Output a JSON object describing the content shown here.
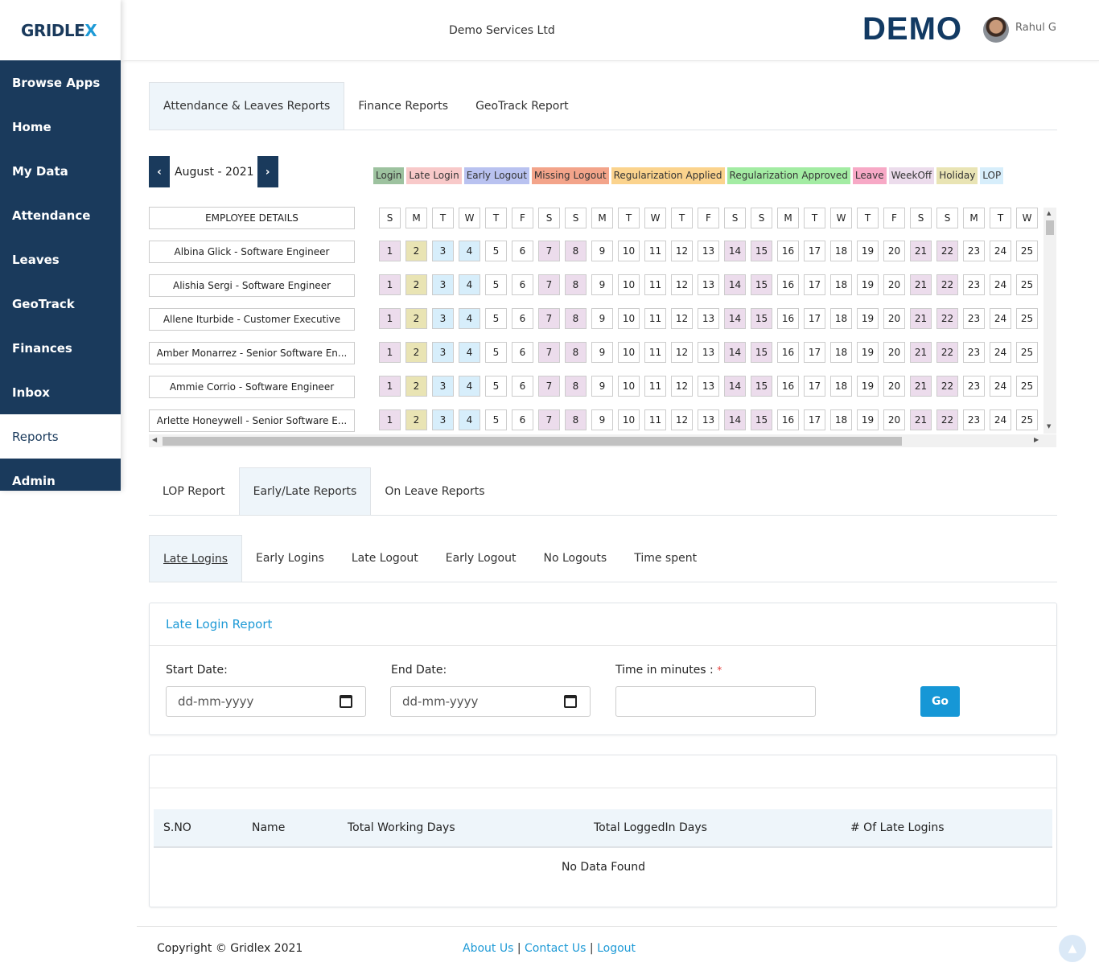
{
  "sidebar": {
    "logo_main": "GRIDLE",
    "logo_x": "X",
    "items": [
      {
        "label": "Browse Apps"
      },
      {
        "label": "Home"
      },
      {
        "label": "My Data"
      },
      {
        "label": "Attendance"
      },
      {
        "label": "Leaves"
      },
      {
        "label": "GeoTrack"
      },
      {
        "label": "Finances"
      },
      {
        "label": "Inbox"
      },
      {
        "label": "Reports",
        "active": true
      },
      {
        "label": "Admin"
      }
    ]
  },
  "header": {
    "company": "Demo Services Ltd",
    "brand": "DEMO",
    "user_name": "Rahul G"
  },
  "report_tabs": [
    "Attendance & Leaves Reports",
    "Finance Reports",
    "GeoTrack Report"
  ],
  "calendar": {
    "month": "August - 2021",
    "prev_icon": "chevron-left-icon",
    "next_icon": "chevron-right-icon",
    "legend": [
      {
        "label": "Login",
        "color": "#9dc29f"
      },
      {
        "label": "Late Login",
        "color": "#f8c9c9"
      },
      {
        "label": "Early Logout",
        "color": "#b9c2f0"
      },
      {
        "label": "Missing Logout",
        "color": "#f3a48a"
      },
      {
        "label": "Regularization Applied",
        "color": "#fbd38d"
      },
      {
        "label": "Regularization Approved",
        "color": "#a3eca3"
      },
      {
        "label": "Leave",
        "color": "#f7a9c6"
      },
      {
        "label": "WeekOff",
        "color": "#ecdcec"
      },
      {
        "label": "Holiday",
        "color": "#e9e4b4"
      },
      {
        "label": "LOP",
        "color": "#d7eefb"
      }
    ],
    "employee_header": "EMPLOYEE DETAILS",
    "weekday_letters": [
      "S",
      "M",
      "T",
      "W",
      "T",
      "F",
      "S",
      "S",
      "M",
      "T",
      "W",
      "T",
      "F",
      "S",
      "S",
      "M",
      "T",
      "W",
      "T",
      "F",
      "S",
      "S",
      "M",
      "T",
      "W"
    ],
    "day_numbers": [
      1,
      2,
      3,
      4,
      5,
      6,
      7,
      8,
      9,
      10,
      11,
      12,
      13,
      14,
      15,
      16,
      17,
      18,
      19,
      20,
      21,
      22,
      23,
      24,
      25
    ],
    "day_status": [
      "weekoff",
      "holiday",
      "lop",
      "lop",
      "",
      "",
      "weekoff",
      "weekoff",
      "",
      "",
      "",
      "",
      "",
      "weekoff",
      "weekoff",
      "",
      "",
      "",
      "",
      "",
      "weekoff",
      "weekoff",
      "",
      "",
      ""
    ],
    "employees": [
      "Albina Glick - Software Engineer",
      "Alishia Sergi - Software Engineer",
      "Allene Iturbide - Customer Executive",
      "Amber Monarrez - Senior Software En...",
      "Ammie Corrio - Software Engineer",
      "Arlette Honeywell - Senior Software E..."
    ]
  },
  "report_section_tabs": [
    "LOP Report",
    "Early/Late Reports",
    "On Leave Reports"
  ],
  "sub_tabs": [
    "Late Logins",
    "Early Logins",
    "Late Logout",
    "Early Logout",
    "No Logouts",
    "Time spent"
  ],
  "late_login_form": {
    "title": "Late Login Report",
    "start_label": "Start Date:",
    "start_placeholder": "dd-mm-yyyy",
    "end_label": "End Date:",
    "end_placeholder": "dd-mm-yyyy",
    "minutes_label": "Time in minutes :",
    "required_mark": "*",
    "minutes_value": "",
    "go_label": "Go"
  },
  "results_table": {
    "columns": [
      "S.NO",
      "Name",
      "Total Working Days",
      "Total LoggedIn Days",
      "# Of Late Logins"
    ],
    "empty_text": "No Data Found"
  },
  "footer": {
    "copyright": "Copyright © Gridlex 2021",
    "links": [
      "About Us",
      "Contact Us",
      "Logout"
    ],
    "separator": " | "
  }
}
